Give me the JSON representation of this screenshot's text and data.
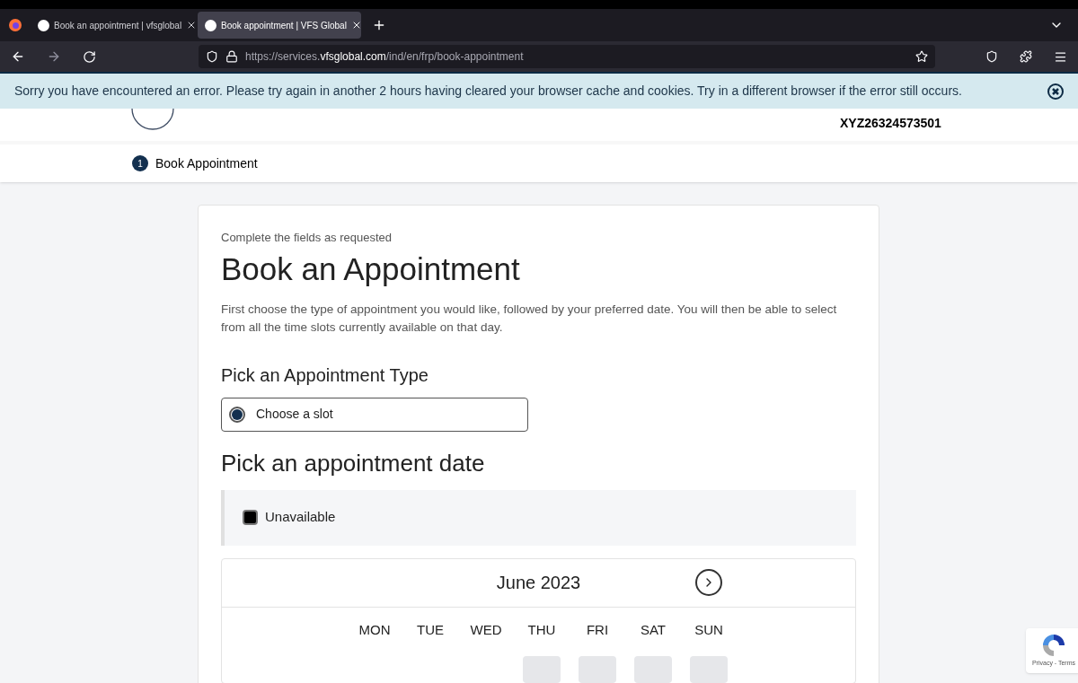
{
  "browser": {
    "tabs": [
      {
        "title": "Book an appointment | vfsglobal",
        "selected": false
      },
      {
        "title": "Book appointment | VFS Global",
        "selected": true
      }
    ],
    "url": {
      "prefix": "https://services.",
      "domain": "vfsglobal.com",
      "path": "/ind/en/frp/book-appointment"
    }
  },
  "error_banner": {
    "message": "Sorry you have encountered an error. Please try again in another 2 hours having cleared your browser cache and cookies. Try in a different browser if the error still occurs."
  },
  "header": {
    "reference": "XYZ26324573501"
  },
  "steps": [
    {
      "number": "1",
      "label": "Book Appointment"
    }
  ],
  "form": {
    "subtitle": "Complete the fields as requested",
    "title": "Book an Appointment",
    "intro": "First choose the type of appointment you would like, followed by your preferred date. You will then be able to select from all the time slots currently available on that day.",
    "type_heading": "Pick an Appointment Type",
    "types": [
      {
        "label": "Choose a slot",
        "selected": true
      }
    ],
    "date_heading": "Pick an appointment date",
    "legend": [
      {
        "label": "Unavailable",
        "color": "#000000"
      }
    ],
    "calendar": {
      "month": "June 2023",
      "weekdays": [
        "MON",
        "TUE",
        "WED",
        "THU",
        "FRI",
        "SAT",
        "SUN"
      ],
      "first_week": [
        {
          "kind": "blank"
        },
        {
          "kind": "blank"
        },
        {
          "kind": "blank"
        },
        {
          "kind": "day"
        },
        {
          "kind": "day"
        },
        {
          "kind": "day"
        },
        {
          "kind": "day"
        }
      ]
    }
  },
  "recaptcha": {
    "links": "Privacy - Terms"
  }
}
